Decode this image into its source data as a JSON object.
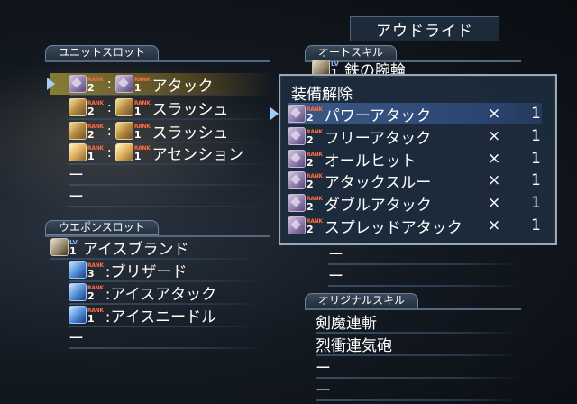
{
  "title": "アウドライド",
  "unit_slot": {
    "header": "ユニットスロット",
    "rows": [
      {
        "icon1": "cube-icon",
        "rank1": "2",
        "icon2": "cube-icon",
        "rank2": "1",
        "name": "アタック"
      },
      {
        "icon1": "sword-icon",
        "rank1": "2",
        "icon2": "sword-icon",
        "rank2": "1",
        "name": "スラッシュ"
      },
      {
        "icon1": "sword-icon",
        "rank1": "2",
        "icon2": "sword-icon",
        "rank2": "1",
        "name": "スラッシュ"
      },
      {
        "icon1": "wing-icon",
        "rank1": "1",
        "icon2": "wing-icon",
        "rank2": "1",
        "name": "アセンション"
      }
    ],
    "empty": [
      "ー",
      "ー"
    ]
  },
  "weapon_slot": {
    "header": "ウエポンスロット",
    "weapon": {
      "level": "1",
      "name": "アイスブランド"
    },
    "skills": [
      {
        "rank": "3",
        "name": ":ブリザード"
      },
      {
        "rank": "2",
        "name": ":アイスアタック"
      },
      {
        "rank": "1",
        "name": ":アイスニードル"
      }
    ],
    "empty": "ー"
  },
  "auto_skill": {
    "header": "オートスキル",
    "first_item": {
      "level": "1",
      "name": "鉄の腕輪"
    },
    "empty": [
      "ー",
      "ー"
    ]
  },
  "original_skill": {
    "header": "オリジナルスキル",
    "items": [
      "剣魔連斬",
      "烈衝連気砲"
    ],
    "empty": [
      "ー",
      "ー"
    ]
  },
  "popup": {
    "title": "装備解除",
    "items": [
      {
        "rank": "2",
        "name": "パワーアタック",
        "mult": "×",
        "qty": "1"
      },
      {
        "rank": "2",
        "name": "フリーアタック",
        "mult": "×",
        "qty": "1"
      },
      {
        "rank": "2",
        "name": "オールヒット",
        "mult": "×",
        "qty": "1"
      },
      {
        "rank": "2",
        "name": "アタックスルー",
        "mult": "×",
        "qty": "1"
      },
      {
        "rank": "2",
        "name": "ダブルアタック",
        "mult": "×",
        "qty": "1"
      },
      {
        "rank": "2",
        "name": "スプレッドアタック",
        "mult": "×",
        "qty": "1"
      }
    ]
  },
  "labels": {
    "rank": "RANK",
    "lv": "LV",
    "colon": ":"
  }
}
